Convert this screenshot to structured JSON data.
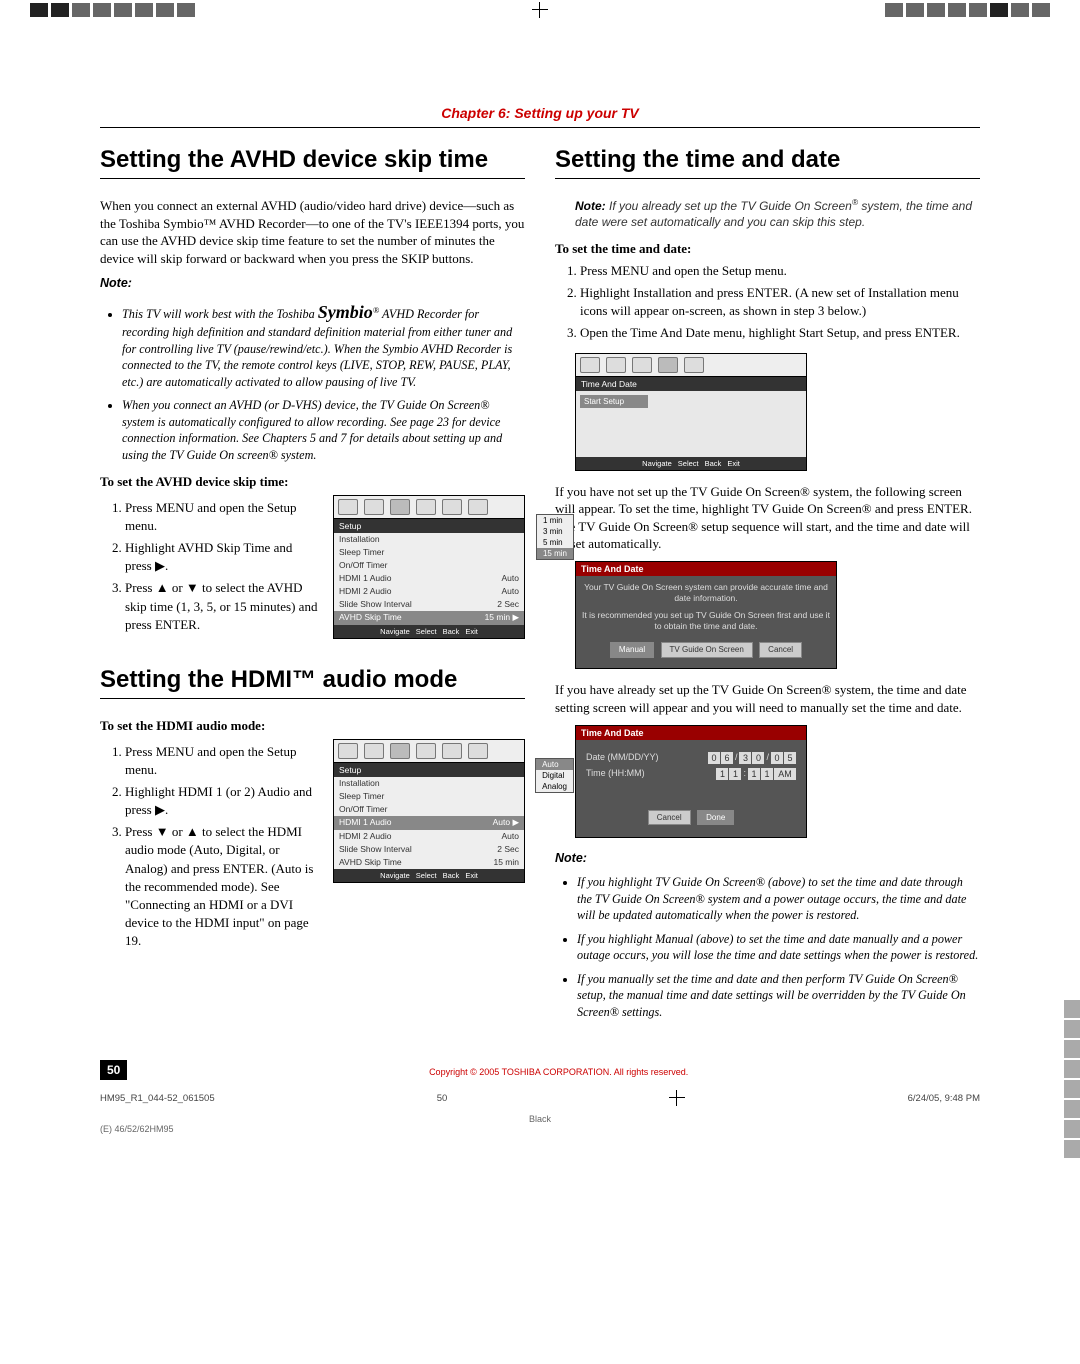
{
  "chapter_header": "Chapter 6: Setting up your TV",
  "page_number": "50",
  "copyright": "Copyright © 2005 TOSHIBA CORPORATION. All rights reserved.",
  "footer_left": "HM95_R1_044-52_061505",
  "footer_page": "50",
  "footer_right": "6/24/05, 9:48 PM",
  "footer_bottom1": "Black",
  "footer_bottom2": "(E) 46/52/62HM95",
  "left": {
    "sec1_title": "Setting the AVHD device skip time",
    "sec1_intro": "When you connect an external AVHD (audio/video hard drive) device—such as the Toshiba Symbio™ AVHD Recorder—to one of the TV's IEEE1394 ports, you can use the AVHD device skip time feature to set the number of minutes the device will skip forward or backward when you press the SKIP buttons.",
    "note_label": "Note:",
    "note_b1": "This TV will work best with the Toshiba Symbio™ AVHD Recorder for recording high definition and standard definition material from either tuner and for controlling live TV (pause/rewind/etc.). When the Symbio AVHD Recorder is connected to the TV, the remote control keys (LIVE, STOP, REW, PAUSE, PLAY, etc.) are automatically activated to allow pausing of live TV.",
    "note_b2": "When you connect an AVHD (or D-VHS) device, the TV Guide On Screen® system is automatically configured to allow recording. See page 23 for device connection information. See Chapters 5 and 7 for details about setting up and using the TV Guide On screen® system.",
    "proc1_head": "To set the AVHD device skip time:",
    "proc1_s1": "Press MENU and open the Setup menu.",
    "proc1_s2": "Highlight AVHD Skip Time and press ▶.",
    "proc1_s3": "Press ▲ or ▼ to select the AVHD skip time (1, 3, 5, or 15 minutes) and press ENTER.",
    "sec2_title": "Setting the HDMI™ audio mode",
    "proc2_head": "To set the HDMI audio mode:",
    "proc2_s1": "Press MENU and open the Setup menu.",
    "proc2_s2": "Highlight HDMI 1 (or 2) Audio and press ▶.",
    "proc2_s3": "Press ▼ or ▲ to select the HDMI audio mode (Auto, Digital, or Analog) and press ENTER. (Auto is the recommended mode). See \"Connecting an HDMI or a DVI device to the HDMI input\" on page 19.",
    "setup_panel": {
      "title": "Setup",
      "rows": [
        {
          "l": "Installation",
          "r": ""
        },
        {
          "l": "Sleep Timer",
          "r": ""
        },
        {
          "l": "On/Off Timer",
          "r": ""
        },
        {
          "l": "HDMI 1 Audio",
          "r": "Auto"
        },
        {
          "l": "HDMI 2 Audio",
          "r": "Auto"
        },
        {
          "l": "Slide Show Interval",
          "r": "2 Sec"
        },
        {
          "l": "AVHD Skip Time",
          "r": "15 min ▶"
        }
      ],
      "menu_avhd": [
        "1 min",
        "3 min",
        "5 min",
        "15 min"
      ],
      "menu_hdmi": [
        "Auto",
        "Digital",
        "Analog"
      ],
      "footer_items": [
        "Navigate",
        "Select",
        "Back",
        "Exit"
      ]
    }
  },
  "right": {
    "sec1_title": "Setting the time and date",
    "top_note": "Note: If you already set up the TV Guide On Screen® system, the time and date were set automatically and you can skip this step.",
    "proc_head": "To set the time and date:",
    "s1": "Press MENU and open the Setup menu.",
    "s2": "Highlight Installation and press ENTER. (A new set of Installation menu icons will appear on-screen, as shown in step 3 below.)",
    "s3": "Open the Time And Date menu, highlight Start Setup, and press ENTER.",
    "panel1": {
      "title": "Time And Date",
      "item": "Start Setup",
      "footer": [
        "Navigate",
        "Select",
        "Back",
        "Exit"
      ]
    },
    "para1": "If you have not set up the TV Guide On Screen® system, the following screen will appear. To set the time, highlight TV Guide On Screen® and press ENTER. The TV Guide On Screen® setup sequence will start, and the time and date will be set automatically.",
    "panel2": {
      "title": "Time And Date",
      "line1": "Your TV Guide On Screen system can provide accurate time and date information.",
      "line2": "It is recommended you set up TV Guide On Screen first and use it to obtain the time and date.",
      "buttons": [
        "Manual",
        "TV Guide On Screen",
        "Cancel"
      ]
    },
    "para2": "If you have already set up the TV Guide On Screen® system, the time and date setting screen will appear and you will need to manually set the time and date.",
    "panel3": {
      "title": "Time And Date",
      "date_label": "Date (MM/DD/YY)",
      "date_value": [
        "0",
        "6",
        "/",
        "3",
        "0",
        "/",
        "0",
        "5"
      ],
      "time_label": "Time (HH:MM)",
      "time_value": [
        "1",
        "1",
        ":",
        "1",
        "1",
        " ",
        "AM"
      ],
      "buttons": [
        "Cancel",
        "Done"
      ]
    },
    "bottom_note_label": "Note:",
    "bn1": "If you highlight TV Guide On Screen® (above) to set the time and date through the TV Guide On Screen® system and a power outage occurs, the time and date will be updated automatically when the power is restored.",
    "bn2": "If you highlight Manual (above) to set the time and date manually and a power outage occurs, you will lose the time and date settings when the power is restored.",
    "bn3": "If you manually set the time and date and then perform TV Guide On Screen® setup, the manual time and date settings will be overridden by the TV Guide On Screen® settings."
  }
}
